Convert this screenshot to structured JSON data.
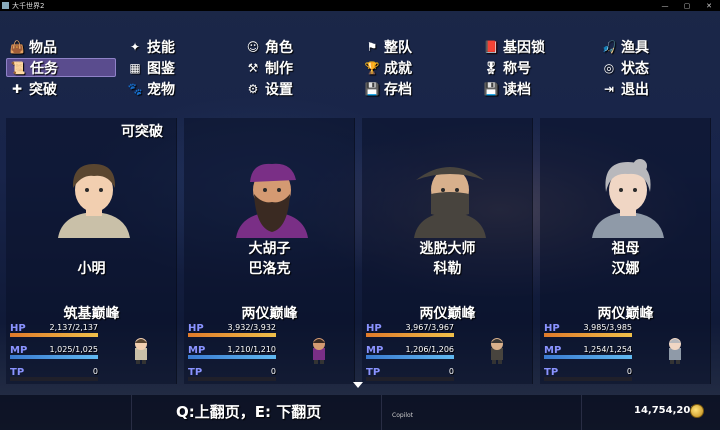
{
  "window": {
    "title": "大千世界2",
    "controls": [
      "—",
      "▢",
      "✕"
    ]
  },
  "menu": {
    "items": [
      {
        "label": "物品",
        "icon": "bag-icon",
        "glyph": "👜"
      },
      {
        "label": "技能",
        "icon": "skill-icon",
        "glyph": "✦"
      },
      {
        "label": "角色",
        "icon": "faces-icon",
        "glyph": "☺"
      },
      {
        "label": "整队",
        "icon": "formation-icon",
        "glyph": "⚑"
      },
      {
        "label": "基因锁",
        "icon": "gene-book-icon",
        "glyph": "📕"
      },
      {
        "label": "渔具",
        "icon": "fishing-rod-icon",
        "glyph": "🎣"
      },
      {
        "label": "任务",
        "icon": "quest-scroll-icon",
        "glyph": "📜",
        "selected": true
      },
      {
        "label": "图鉴",
        "icon": "codex-icon",
        "glyph": "▦"
      },
      {
        "label": "制作",
        "icon": "craft-icon",
        "glyph": "⚒"
      },
      {
        "label": "成就",
        "icon": "trophy-icon",
        "glyph": "🏆"
      },
      {
        "label": "称号",
        "icon": "medal-icon",
        "glyph": "🎖"
      },
      {
        "label": "状态",
        "icon": "status-icon",
        "glyph": "◎"
      },
      {
        "label": "突破",
        "icon": "breakthrough-icon",
        "glyph": "✚"
      },
      {
        "label": "宠物",
        "icon": "pet-icon",
        "glyph": "🐾"
      },
      {
        "label": "设置",
        "icon": "gear-icon",
        "glyph": "⚙"
      },
      {
        "label": "存档",
        "icon": "save-icon",
        "glyph": "💾"
      },
      {
        "label": "读档",
        "icon": "load-icon",
        "glyph": "💾"
      },
      {
        "label": "退出",
        "icon": "exit-icon",
        "glyph": "⇥"
      }
    ]
  },
  "actors": [
    {
      "name1": "小明",
      "name2": "",
      "breakable": "可突破",
      "realm": "筑基巅峰",
      "hp_label": "HP",
      "hp": "2,137/2,137",
      "hp_ratio": 1,
      "mp_label": "MP",
      "mp": "1,025/1,025",
      "mp_ratio": 1,
      "tp_label": "TP",
      "tp": "0",
      "tp_ratio": 0,
      "hair": "#5a4630",
      "skin": "#f2cfb0",
      "outfit": "#c9c0a8"
    },
    {
      "name1": "大胡子",
      "name2": "巴洛克",
      "breakable": "",
      "realm": "两仪巅峰",
      "hp_label": "HP",
      "hp": "3,932/3,932",
      "hp_ratio": 1,
      "mp_label": "MP",
      "mp": "1,210/1,210",
      "mp_ratio": 1,
      "tp_label": "TP",
      "tp": "0",
      "tp_ratio": 0,
      "hair": "#3a2a22",
      "skin": "#d49a72",
      "outfit": "#7a2f86"
    },
    {
      "name1": "逃脱大师",
      "name2": "科勒",
      "breakable": "",
      "realm": "两仪巅峰",
      "hp_label": "HP",
      "hp": "3,967/3,967",
      "hp_ratio": 1,
      "mp_label": "MP",
      "mp": "1,206/1,206",
      "mp_ratio": 1,
      "tp_label": "TP",
      "tp": "0",
      "tp_ratio": 0,
      "hair": "#3a3836",
      "skin": "#d8b08c",
      "outfit": "#48443e"
    },
    {
      "name1": "祖母",
      "name2": "汉娜",
      "breakable": "",
      "realm": "两仪巅峰",
      "hp_label": "HP",
      "hp": "3,985/3,985",
      "hp_ratio": 1,
      "mp_label": "MP",
      "mp": "1,254/1,254",
      "mp_ratio": 1,
      "tp_label": "TP",
      "tp": "0",
      "tp_ratio": 0,
      "hair": "#b8b8bc",
      "skin": "#f0d6c4",
      "outfit": "#8f9aa8"
    }
  ],
  "footer": {
    "page_hint": "Q:上翻页，E: 下翻页",
    "copilot": "Copilot",
    "gold": "14,754,201"
  }
}
